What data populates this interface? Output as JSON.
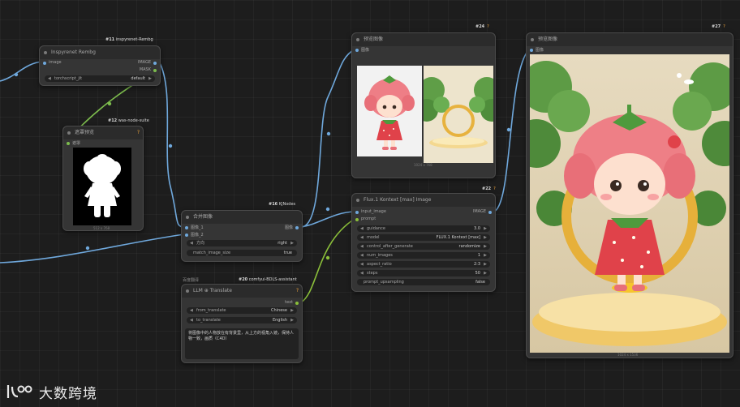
{
  "colors": {
    "wire_image": "#6fa8dc",
    "wire_mask": "#7cbb4d",
    "wire_string": "#8bbf3a",
    "canvas": "#1d1d1d",
    "node_bg": "#353535",
    "badge_question": "#f0a53c"
  },
  "nodes": {
    "inspyrenet": {
      "id_badge": "#11",
      "class_badge": "inspyrenet-Rembg",
      "title": "Inspyrenet Rembg",
      "input_image": "image",
      "output_image": "IMAGE",
      "output_mask": "MASK",
      "widget_label": "torchscript_jit",
      "widget_value": "default"
    },
    "mask_preview": {
      "id_badge": "#12",
      "class_badge": "was-node-suite",
      "title": "遮罩预览",
      "input_mask": "遮罩",
      "caption": "512 x 768"
    },
    "image_combine": {
      "id_badge": "#16",
      "class_badge": "KJNodes",
      "title": "合并图像",
      "input_1": "图像_1",
      "input_2": "图像_2",
      "output": "图像",
      "widget1_label": "方向",
      "widget1_value": "right",
      "widget2_label": "match_image_size",
      "widget2_value": "true"
    },
    "preview_top": {
      "id_badge": "#24",
      "title": "预览图像",
      "input": "图像",
      "caption": "1024 x 768"
    },
    "flux_kontext": {
      "id_badge": "#22",
      "title": "Flux.1 Kontext [max] Image",
      "input_image": "input_image",
      "input_prompt": "prompt",
      "output": "IMAGE",
      "widgets": [
        {
          "label": "guidance",
          "value": "3.0"
        },
        {
          "label": "model",
          "value": "FLUX.1 Kontext [max]"
        },
        {
          "label": "control_after_generate",
          "value": "randomize"
        },
        {
          "label": "num_images",
          "value": "1"
        },
        {
          "label": "aspect_ratio",
          "value": "2:3"
        },
        {
          "label": "steps",
          "value": "50"
        },
        {
          "label": "prompt_upsampling",
          "value": "false"
        }
      ]
    },
    "preview_right": {
      "id_badge": "#27",
      "title": "预览图像",
      "input": "图像",
      "caption": "1024 x 1536"
    },
    "translate": {
      "id_badge": "#20",
      "class_badge": "comfyui-BDLS-assistant",
      "group_label": "百度翻译",
      "title": "LLM ⊕ Translate",
      "output": "text",
      "widgets": [
        {
          "label": "from_translate",
          "value": "Chinese"
        },
        {
          "label": "to_translate",
          "value": "English"
        }
      ],
      "text": "将图像中的人物放在有背景里，从上方的视角入镜，保持人物一致，画质（C4D）"
    }
  },
  "logo": {
    "text": "大数跨境"
  }
}
